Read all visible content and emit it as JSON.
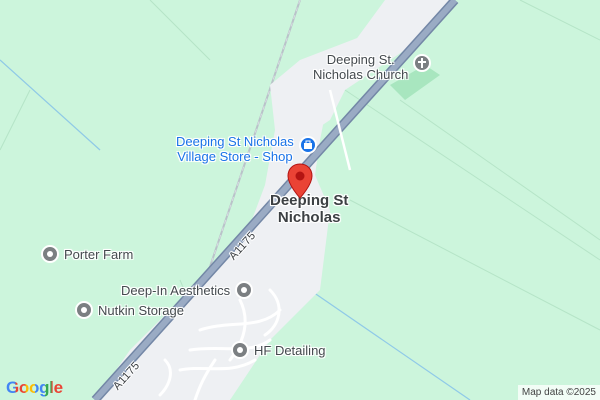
{
  "town": {
    "line1": "Deeping St",
    "line2": "Nicholas"
  },
  "road": {
    "name1": "A1175",
    "name2": "A1175"
  },
  "pois": {
    "church": {
      "line1": "Deeping St.",
      "line2": "Nicholas Church",
      "icon": "cross-icon"
    },
    "shop": {
      "line1": "Deeping St Nicholas",
      "line2": "Village Store - Shop",
      "icon": "shop-icon"
    },
    "porter_farm": {
      "label": "Porter Farm",
      "icon": "place-icon"
    },
    "deep_in": {
      "label": "Deep-In Aesthetics",
      "icon": "place-icon"
    },
    "nutkin": {
      "label": "Nutkin Storage",
      "icon": "place-icon"
    },
    "hf_detailing": {
      "label": "HF Detailing",
      "icon": "place-icon"
    }
  },
  "branding": {
    "logo": "Google",
    "attribution": "Map data ©2025"
  },
  "colors": {
    "land": "#ccf5dc",
    "urban": "#eef0f3",
    "road": "#8fa2bd",
    "road_edge": "#7387a6",
    "park": "#a8e6bf",
    "pin": "#ea4335",
    "poi_blue": "#1a73e8",
    "poi_gray": "#7b7f82"
  }
}
